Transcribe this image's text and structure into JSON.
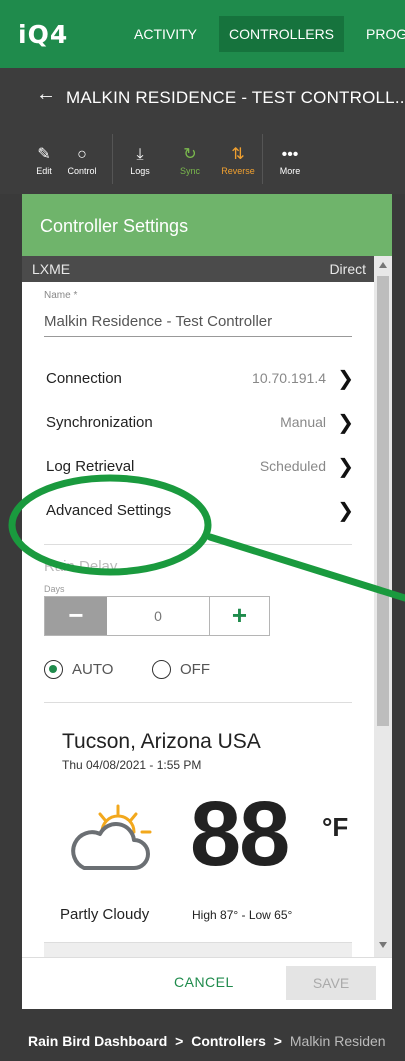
{
  "topnav": {
    "logo": "iQ4",
    "tabs": [
      {
        "label": "ACTIVITY"
      },
      {
        "label": "CONTROLLERS",
        "active": true
      },
      {
        "label": "PROG"
      }
    ]
  },
  "page": {
    "back_icon": "arrow-left-icon",
    "title": "MALKIN RESIDENCE - TEST CONTROLL..."
  },
  "toolbar": {
    "items": [
      {
        "label": "Edit",
        "icon": "pencil-icon"
      },
      {
        "label": "Control",
        "icon": "circle-icon"
      },
      {
        "label": "Logs",
        "icon": "download-icon"
      },
      {
        "label": "Sync",
        "icon": "sync-icon"
      },
      {
        "label": "Reverse",
        "icon": "reverse-arrows-icon"
      },
      {
        "label": "More",
        "icon": "ellipsis-icon"
      }
    ],
    "sync_color": "#7ab84d",
    "reverse_color": "#f0a030"
  },
  "panel": {
    "title": "Controller Settings",
    "model": "LXME",
    "connection_type": "Direct",
    "name_label": "Name *",
    "name_value": "Malkin Residence - Test Controller",
    "rows": [
      {
        "label": "Connection",
        "value": "10.70.191.4"
      },
      {
        "label": "Synchronization",
        "value": "Manual"
      },
      {
        "label": "Log Retrieval",
        "value": "Scheduled"
      },
      {
        "label": "Advanced Settings",
        "value": ""
      }
    ],
    "rain_delay": {
      "label": "Rain Delay",
      "unit_label": "Days",
      "minus": "−",
      "value": "0",
      "plus": "+"
    },
    "mode": {
      "options": [
        "AUTO",
        "OFF"
      ],
      "selected": "AUTO"
    },
    "weather": {
      "location": "Tucson, Arizona USA",
      "datetime": "Thu 04/08/2021 - 1:55 PM",
      "icon": "partly-cloudy-icon",
      "temperature": "88",
      "unit": "°F",
      "condition": "Partly Cloudy",
      "high_low": "High 87° - Low 65°"
    }
  },
  "footer": {
    "cancel_label": "CANCEL",
    "save_label": "SAVE"
  },
  "breadcrumb": {
    "items": [
      "Rain Bird Dashboard",
      "Controllers"
    ],
    "separator": ">",
    "current": "Malkin Residen"
  },
  "colors": {
    "brand_green": "#1f8b4c",
    "panel_header": "#6fb46b",
    "annotation_green": "#1a9a3e"
  }
}
